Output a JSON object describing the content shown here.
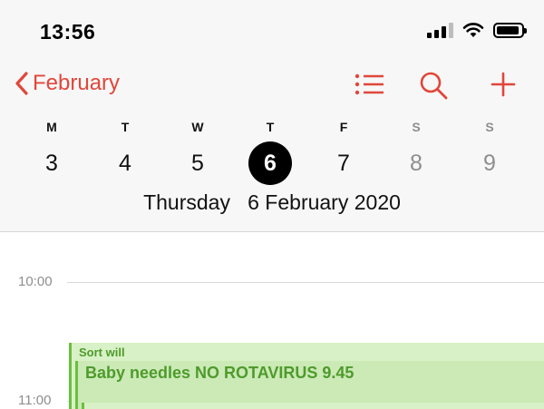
{
  "status_bar": {
    "time": "13:56"
  },
  "nav": {
    "back_label": "February"
  },
  "week": {
    "days": [
      {
        "letter": "M",
        "date": "3",
        "weekend": false,
        "selected": false
      },
      {
        "letter": "T",
        "date": "4",
        "weekend": false,
        "selected": false
      },
      {
        "letter": "W",
        "date": "5",
        "weekend": false,
        "selected": false
      },
      {
        "letter": "T",
        "date": "6",
        "weekend": false,
        "selected": true
      },
      {
        "letter": "F",
        "date": "7",
        "weekend": false,
        "selected": false
      },
      {
        "letter": "S",
        "date": "8",
        "weekend": true,
        "selected": false
      },
      {
        "letter": "S",
        "date": "9",
        "weekend": true,
        "selected": false
      }
    ]
  },
  "selected_date": {
    "weekday": "Thursday",
    "full": "6 February 2020"
  },
  "timeline": {
    "hours": [
      "10:00",
      "11:00"
    ]
  },
  "events": [
    {
      "title": "Sort will"
    },
    {
      "title": "Baby needles NO ROTAVIRUS 9.45"
    },
    {
      "title": ""
    }
  ],
  "colors": {
    "accent": "#e0473b",
    "event_fill": "#d8f1c6",
    "event_text": "#4e9b2c",
    "event_border": "#6abf3c"
  },
  "icons": {
    "back": "chevron-left-icon",
    "list": "list-icon",
    "search": "search-icon",
    "add": "plus-icon"
  }
}
